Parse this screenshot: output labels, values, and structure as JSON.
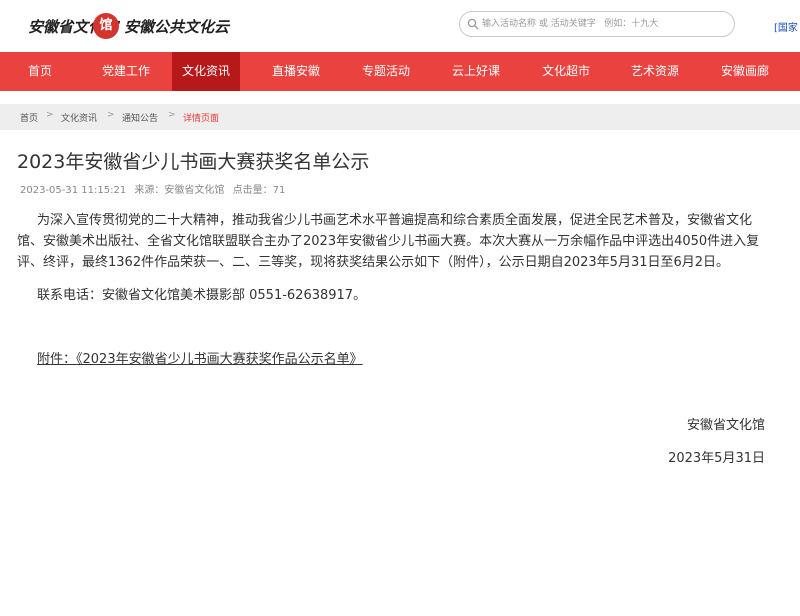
{
  "header": {
    "logo_left_text": "安徽省文化馆",
    "logo_seal_text": "馆",
    "logo_right_text": "安徽公共文化云",
    "search_placeholder": "输入活动名称 或 活动关键字   例如：十九大",
    "top_link": "[国家"
  },
  "nav": {
    "items": [
      {
        "label": "首页"
      },
      {
        "label": "党建工作"
      },
      {
        "label": "文化资讯"
      },
      {
        "label": "直播安徽"
      },
      {
        "label": "专题活动"
      },
      {
        "label": "云上好课"
      },
      {
        "label": "文化超市"
      },
      {
        "label": "艺术资源"
      },
      {
        "label": "安徽画廊"
      }
    ],
    "active_index": 2
  },
  "breadcrumb": {
    "items": [
      "首页",
      "文化资讯",
      "通知公告",
      "详情页面"
    ],
    "separator": ">"
  },
  "article": {
    "title": "2023年安徽省少儿书画大赛获奖名单公示",
    "date": "2023-05-31 11:15:21",
    "source": "来源：安徽省文化馆",
    "clicks": "点击量：71",
    "body": "为深入宣传贯彻党的二十大精神，推动我省少儿书画艺术水平普遍提高和综合素质全面发展，促进全民艺术普及，安徽省文化馆、安徽美术出版社、全省文化馆联盟联合主办了2023年安徽省少儿书画大赛。本次大赛从一万余幅作品中评选出4050件进入复评、终评，最终1362件作品荣获一、二、三等奖，现将获奖结果公示如下（附件），公示日期自2023年5月31日至6月2日。",
    "contact": "联系电话：安徽省文化馆美术摄影部  0551-62638917。",
    "attachment": "附件：《2023年安徽省少儿书画大赛获奖作品公示名单》",
    "sign_org": "安徽省文化馆",
    "sign_date": "2023年5月31日"
  },
  "colors": {
    "nav_bg": "#e9423f",
    "nav_active_bg": "#b7191b",
    "breadcrumb_current": "#e23b38",
    "link_blue": "#1a4fb5"
  }
}
